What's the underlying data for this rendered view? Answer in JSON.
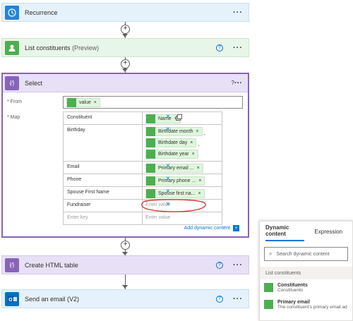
{
  "recurrence": {
    "title": "Recurrence"
  },
  "list_constituents": {
    "title": "List constituents",
    "tag": "(Preview)"
  },
  "select": {
    "title": "Select",
    "from_label": "* From",
    "map_label": "* Map",
    "from_token": "value",
    "rows": [
      {
        "key": "Constituent",
        "tokens": [
          "Name"
        ]
      },
      {
        "key": "Birthday",
        "tokens": [
          "Birthdate month",
          "Birthdate day",
          "Birthdate year"
        ]
      },
      {
        "key": "Email",
        "tokens": [
          "Primary email ..."
        ]
      },
      {
        "key": "Phone",
        "tokens": [
          "Primary phone ..."
        ]
      },
      {
        "key": "Spouse First Name",
        "tokens": [
          "Spouse first na..."
        ]
      },
      {
        "key": "Fundraiser",
        "placeholder": "Enter value"
      }
    ],
    "new_key_placeholder": "Enter key",
    "new_value_placeholder": "Enter value",
    "add_dynamic": "Add dynamic content"
  },
  "html_table": {
    "title": "Create HTML table"
  },
  "email": {
    "title": "Send an email (V2)"
  },
  "dynamic_panel": {
    "tab_dynamic": "Dynamic content",
    "tab_expression": "Expression",
    "search_placeholder": "Search dynamic content",
    "section": "List constituents",
    "items": [
      {
        "name": "Constituents",
        "desc": "Constituents"
      },
      {
        "name": "Primary email",
        "desc": "The constituent's primary email ad"
      }
    ]
  },
  "colors": {
    "trigger": "#0f6cbd",
    "connector": "#4caf50",
    "select": "#8764b8",
    "email": "#0072c6"
  }
}
